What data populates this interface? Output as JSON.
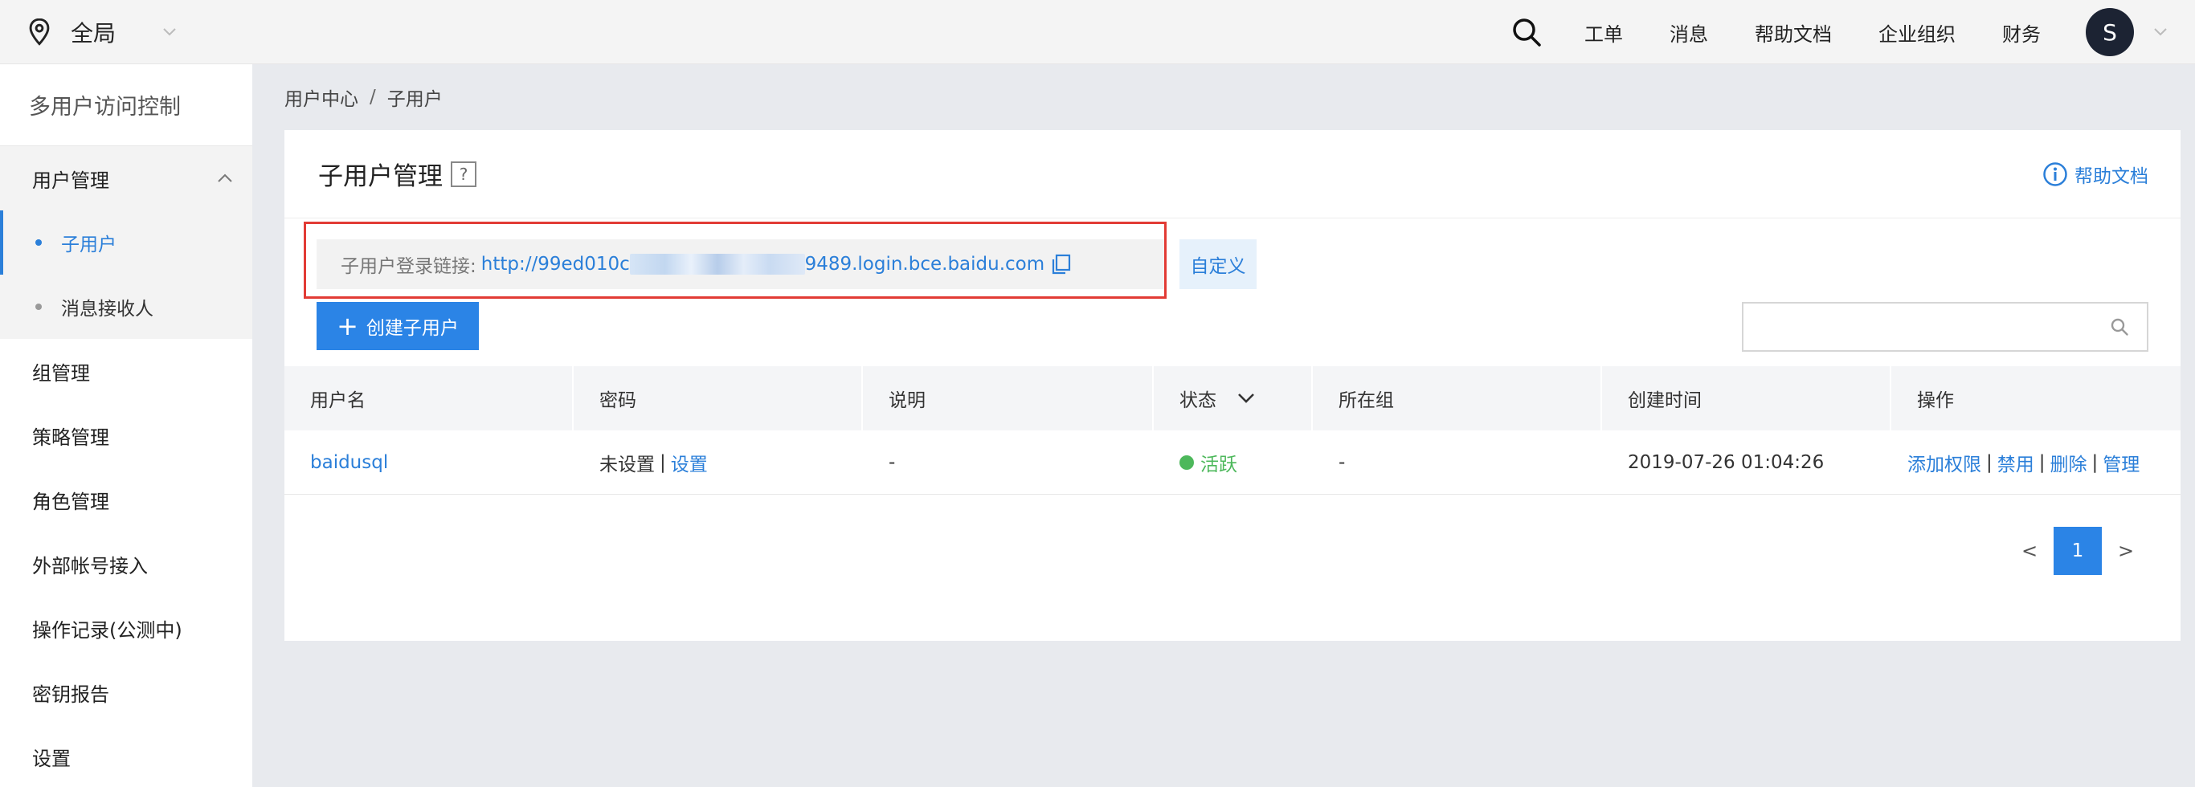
{
  "header": {
    "region_label": "全局",
    "nav": [
      "工单",
      "消息",
      "帮助文档",
      "企业组织",
      "财务"
    ],
    "avatar_letter": "S"
  },
  "sidebar": {
    "title": "多用户访问控制",
    "group": {
      "label": "用户管理",
      "children": [
        "子用户",
        "消息接收人"
      ]
    },
    "items": [
      "组管理",
      "策略管理",
      "角色管理",
      "外部帐号接入",
      "操作记录(公测中)",
      "密钥报告",
      "设置"
    ]
  },
  "breadcrumb": {
    "parent": "用户中心",
    "separator": "/",
    "current": "子用户"
  },
  "card": {
    "title": "子用户管理",
    "help_q": "?",
    "help_link": "帮助文档",
    "login_label": "子用户登录链接:",
    "login_url_start": "http://99ed010c",
    "login_url_hidden": "xxxxxxxxxxxxxxxx",
    "login_url_end": "9489.login.bce.baidu.com",
    "custom_button": "自定义",
    "create_button": "创建子用户",
    "search_placeholder": ""
  },
  "table": {
    "columns": [
      "用户名",
      "密码",
      "说明",
      "状态",
      "所在组",
      "创建时间",
      "操作"
    ],
    "rows": [
      {
        "username": "baidusql",
        "password_status": "未设置",
        "password_action": "设置",
        "description": "-",
        "status": "活跃",
        "group": "-",
        "created": "2019-07-26 01:04:26",
        "actions": [
          "添加权限",
          "禁用",
          "删除",
          "管理"
        ]
      }
    ],
    "separator": "|"
  },
  "pagination": {
    "prev": "<",
    "current": "1",
    "next": ">"
  },
  "colors": {
    "accent": "#2b84e6",
    "link": "#2b7fd9",
    "active_status": "#4db85b",
    "highlight_frame": "#e23b35"
  }
}
